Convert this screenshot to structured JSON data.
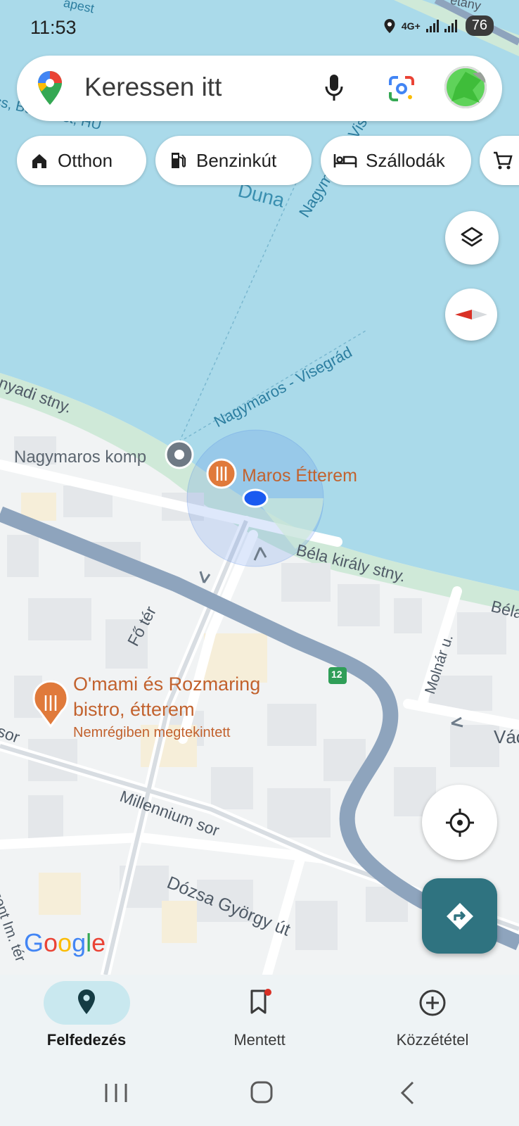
{
  "status_bar": {
    "time": "11:53",
    "network": "4G+",
    "battery": "76"
  },
  "search": {
    "placeholder": "Keressen itt"
  },
  "chips": [
    {
      "label": "Otthon",
      "icon": "home-icon"
    },
    {
      "label": "Benzinkút",
      "icon": "gas-station-icon"
    },
    {
      "label": "Szállodák",
      "icon": "hotel-bed-icon"
    },
    {
      "label": "",
      "icon": "shopping-cart-icon"
    }
  ],
  "map": {
    "labels": {
      "river": "Duna",
      "ferry_route_1": "Nagymaros - Visegrád",
      "ferry_route_2": "Nagymaros - Visegrád",
      "ferry": "Nagymaros komp",
      "restaurant_1": "Maros Étterem",
      "restaurant_2_line1": "O'mami és Rozmaring",
      "restaurant_2_line2": "bistro, étterem",
      "restaurant_2_note": "Nemrégiben megtekintett",
      "street_bela": "Béla király stny.",
      "street_bela_2": "Béla",
      "street_fo": "Fő tér",
      "street_molnar": "Molnár u.",
      "street_millennium": "Millennium sor",
      "street_dozsa": "Dózsa György út",
      "street_hunyadi": "nyadi stny.",
      "street_sor": "sor",
      "street_vac": "Vác",
      "street_szent": "Szent Im. tér",
      "road_number": "12",
      "top_label_1": "apest",
      "top_label_2": "etány",
      "top_label_3": "cs, Budapest, HU",
      "google": "Google"
    },
    "colors": {
      "water": "#aadaea",
      "land": "#f1f3f4",
      "main_road": "#8ea4bd",
      "accent": "#2f7380",
      "poi": "#e07a3b",
      "location": "#1a5af0"
    }
  },
  "nav": [
    {
      "label": "Felfedezés",
      "icon": "explore-pin-icon",
      "selected": true
    },
    {
      "label": "Mentett",
      "icon": "bookmark-icon",
      "badge": true
    },
    {
      "label": "Közzététel",
      "icon": "add-circle-icon"
    }
  ]
}
